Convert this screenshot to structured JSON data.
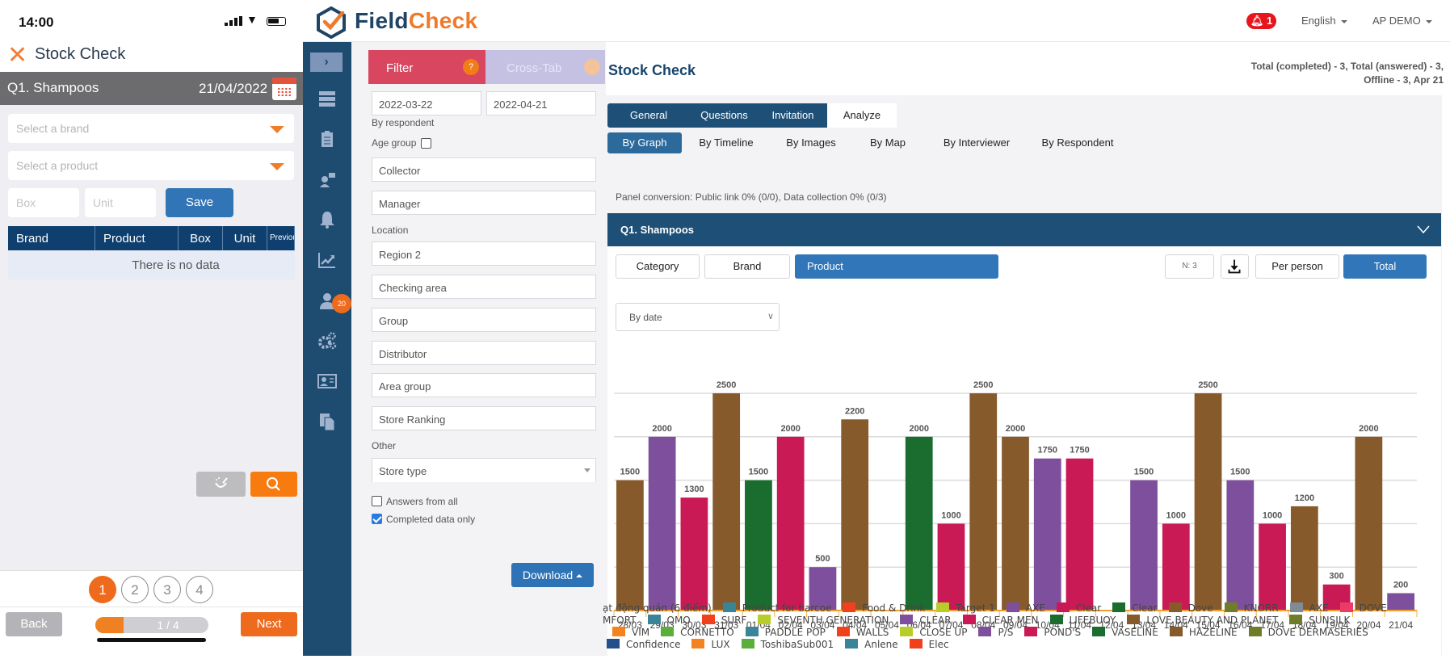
{
  "phone": {
    "status_time": "14:00",
    "title": "Stock Check",
    "question": "Q1. Shampoos",
    "date": "21/04/2022",
    "brand_placeholder": "Select a brand",
    "product_placeholder": "Select a product",
    "box_placeholder": "Box",
    "unit_placeholder": "Unit",
    "save_label": "Save",
    "table_headers": [
      "Brand",
      "Product",
      "Box",
      "Unit",
      "Previous"
    ],
    "empty_text": "There is no data",
    "steps": [
      "1",
      "2",
      "3",
      "4"
    ],
    "active_step": 1,
    "back_label": "Back",
    "next_label": "Next",
    "progress_text": "1 / 4",
    "progress_fraction": 0.25
  },
  "header": {
    "logo_part1": "Field",
    "logo_part2": "Check",
    "notifications": "1",
    "language": "English",
    "user": "AP DEMO"
  },
  "sidebar": {
    "toggle_icon": "chevron-right-icon",
    "items": [
      {
        "icon": "server-icon"
      },
      {
        "icon": "clipboard-icon"
      },
      {
        "icon": "presenter-icon"
      },
      {
        "icon": "bell-icon"
      },
      {
        "icon": "trend-chart-icon"
      },
      {
        "icon": "user-icon",
        "badge": "20"
      },
      {
        "icon": "gears-icon"
      },
      {
        "icon": "id-card-icon"
      },
      {
        "icon": "documents-icon"
      }
    ]
  },
  "filter": {
    "filter_tab": "Filter",
    "crosstab_tab": "Cross-Tab",
    "help": "?",
    "date_from": "2022-03-22",
    "date_to": "2022-04-21",
    "by_respondent": "By respondent",
    "age_group": "Age group",
    "collector": "Collector",
    "manager": "Manager",
    "location_label": "Location",
    "region": "Region 2",
    "checking_area": "Checking area",
    "group": "Group",
    "distributor": "Distributor",
    "area_group": "Area group",
    "store_ranking": "Store Ranking",
    "other_label": "Other",
    "store_type": "Store type",
    "answers_from_all": "Answers from all",
    "answers_from_all_checked": false,
    "completed_only": "Completed data only",
    "completed_only_checked": true,
    "download_label": "Download"
  },
  "main": {
    "title": "Stock Check",
    "stats_line1": "Total (completed) - 3, Total (answered) - 3,",
    "stats_line2": "Offline - 3, Apr 21",
    "tabs": [
      "General",
      "Questions",
      "Invitation",
      "Analyze"
    ],
    "active_tab": "Analyze",
    "subtabs": [
      "By Graph",
      "By Timeline",
      "By Images",
      "By Map",
      "By Interviewer",
      "By Respondent"
    ],
    "active_subtab": "By Graph",
    "panel_conversion": "Panel conversion: Public link 0% (0/0), Data collection 0% (0/3)",
    "question_header": "Q1.  Shampoos",
    "segments": [
      "Category",
      "Brand",
      "Product"
    ],
    "active_segment": "Product",
    "n_label": "N: 3",
    "per_person": "Per person",
    "total": "Total",
    "active_mode": "Total",
    "group_by": "By date"
  },
  "chart_data": {
    "type": "bar",
    "title": "",
    "xlabel": "",
    "ylabel": "",
    "ylim": [
      0,
      2500
    ],
    "grid": true,
    "gridlines": [
      0,
      500,
      1000,
      1500,
      2000,
      2500
    ],
    "categories": [
      "28/03",
      "29/03",
      "30/03",
      "31/03",
      "01/04",
      "02/04",
      "03/04",
      "04/04",
      "05/04",
      "06/04",
      "07/04",
      "08/04",
      "09/04",
      "10/04",
      "11/04",
      "12/04",
      "13/04",
      "14/04",
      "15/04",
      "16/04",
      "17/04",
      "18/04",
      "19/04",
      "20/04",
      "21/04"
    ],
    "values": [
      1500,
      2000,
      1300,
      2500,
      1500,
      2000,
      500,
      2200,
      null,
      2000,
      1000,
      2500,
      2000,
      1750,
      1750,
      null,
      1500,
      1000,
      2500,
      1500,
      1000,
      1200,
      300,
      2000,
      200
    ],
    "bar_series": [
      "Dove",
      "AXE",
      "Clear",
      "Dove",
      "Clear (green)",
      "Clear",
      "AXE",
      "Dove",
      null,
      "Clear (green)",
      "Clear",
      "Dove",
      "Dove",
      "AXE",
      "Clear",
      null,
      "AXE",
      "Clear",
      "Dove",
      "AXE",
      "Clear",
      "Dove",
      "Clear",
      "Dove",
      "AXE"
    ],
    "series_colors": {
      "Dove": "#875a2c",
      "AXE": "#7e4f9c",
      "Clear": "#c91a55",
      "Clear (green)": "#1a6d2e"
    },
    "legend_position": "bottom",
    "legend": [
      [
        {
          "label": "ạt động quán (6 điểm)",
          "color": null
        },
        {
          "label": "Product for barcoe",
          "color": "#3a849a"
        },
        {
          "label": "Food & Drink",
          "color": "#f0401c"
        },
        {
          "label": "Target 1",
          "color": "#b8cc2a"
        },
        {
          "label": "AXE",
          "color": "#7e4f9c"
        },
        {
          "label": "Clear",
          "color": "#c91a55"
        },
        {
          "label": "Clear",
          "color": "#1a6d2e"
        },
        {
          "label": "Dove",
          "color": "#875a2c"
        },
        {
          "label": "KNORR",
          "color": "#6f7d28"
        },
        {
          "label": "AXE",
          "color": "#7f8c96"
        },
        {
          "label": "DOVE",
          "color": "#ec3b67"
        }
      ],
      [
        {
          "label": "MFORT",
          "color": null
        },
        {
          "label": "OMO",
          "color": "#3a849a"
        },
        {
          "label": "SURF",
          "color": "#f0401c"
        },
        {
          "label": "SEVENTH GENERATION",
          "color": "#b8cc2a"
        },
        {
          "label": "CLEAR",
          "color": "#7e4f9c"
        },
        {
          "label": "CLEAR MEN",
          "color": "#c91a55"
        },
        {
          "label": "LIFEBUOY",
          "color": "#1a6d2e"
        },
        {
          "label": "LOVE BEAUTY AND PLANET",
          "color": "#875a2c"
        },
        {
          "label": "SUNSILK",
          "color": "#6f7d28"
        }
      ],
      [
        {
          "label": "VIM",
          "color": "#f58220"
        },
        {
          "label": "CORNETTO",
          "color": "#5aae3c"
        },
        {
          "label": "PADDLE POP",
          "color": "#3a849a"
        },
        {
          "label": "WALLS",
          "color": "#f0401c"
        },
        {
          "label": "CLOSE UP",
          "color": "#b8cc2a"
        },
        {
          "label": "P/S",
          "color": "#7e4f9c"
        },
        {
          "label": "POND'S",
          "color": "#c91a55"
        },
        {
          "label": "VASELINE",
          "color": "#1a6d2e"
        },
        {
          "label": "HAZELINE",
          "color": "#875a2c"
        },
        {
          "label": "DOVE DERMASERIES",
          "color": "#6f7d28"
        }
      ],
      [
        {
          "label": "Confidence",
          "color": "#23508a"
        },
        {
          "label": "LUX",
          "color": "#f58220"
        },
        {
          "label": "ToshibaSub001",
          "color": "#5aae3c"
        },
        {
          "label": "Anlene",
          "color": "#3a849a"
        },
        {
          "label": "Elec",
          "color": "#f0401c"
        }
      ]
    ]
  }
}
